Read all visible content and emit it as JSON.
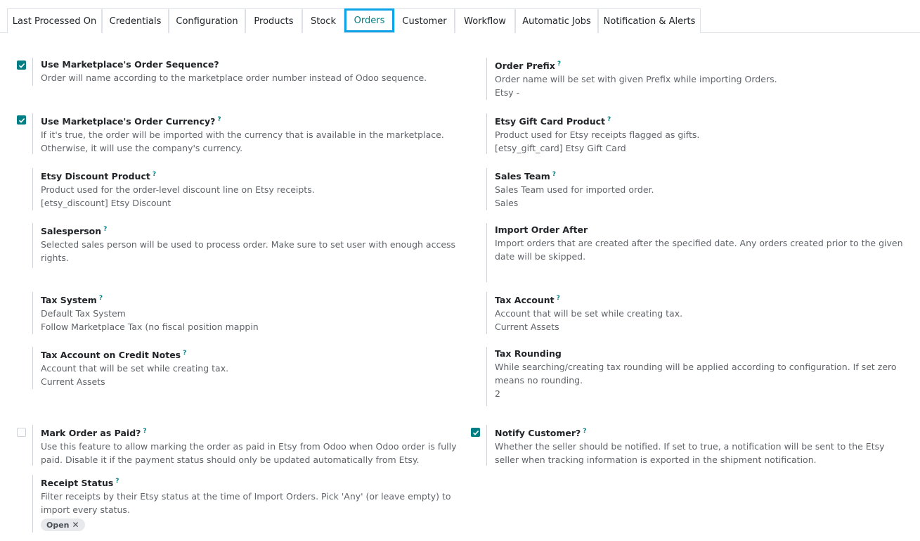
{
  "tabs": [
    {
      "label": "Last Processed On"
    },
    {
      "label": "Credentials"
    },
    {
      "label": "Configuration"
    },
    {
      "label": "Products"
    },
    {
      "label": "Stock"
    },
    {
      "label": "Orders",
      "active": true
    },
    {
      "label": "Customer"
    },
    {
      "label": "Workflow"
    },
    {
      "label": "Automatic Jobs"
    },
    {
      "label": "Notification & Alerts"
    }
  ],
  "settings": {
    "order_sequence": {
      "title": "Use Marketplace's Order Sequence?",
      "desc": "Order will name according to the marketplace order number instead of Odoo sequence.",
      "checked": true
    },
    "order_prefix": {
      "title": "Order Prefix",
      "help": "?",
      "desc": "Order name will be set with given Prefix while importing Orders.",
      "value": "Etsy -"
    },
    "order_currency": {
      "title": "Use Marketplace's Order Currency?",
      "help": "?",
      "desc": "If it's true, the order will be imported with the currency that is available in the marketplace. Otherwise, it will use the company's currency.",
      "checked": true
    },
    "gift_card_product": {
      "title": "Etsy Gift Card Product",
      "help": "?",
      "desc": "Product used for Etsy receipts flagged as gifts.",
      "value": "[etsy_gift_card] Etsy Gift Card"
    },
    "discount_product": {
      "title": "Etsy Discount Product",
      "help": "?",
      "desc": "Product used for the order-level discount line on Etsy receipts.",
      "value": "[etsy_discount] Etsy Discount"
    },
    "sales_team": {
      "title": "Sales Team",
      "help": "?",
      "desc": "Sales Team used for imported order.",
      "value": "Sales"
    },
    "salesperson": {
      "title": "Salesperson",
      "help": "?",
      "desc": "Selected sales person will be used to process order. Make sure to set user with enough access rights.",
      "value": ""
    },
    "import_after": {
      "title": "Import Order After",
      "desc": "Import orders that are created after the specified date. Any orders created prior to the given date will be skipped.",
      "value": ""
    },
    "tax_system": {
      "title": "Tax System",
      "help": "?",
      "desc": "Default Tax System",
      "value": "Follow Marketplace Tax (no fiscal position mappin"
    },
    "tax_account": {
      "title": "Tax Account",
      "help": "?",
      "desc": "Account that will be set while creating tax.",
      "value": "Current Assets"
    },
    "tax_account_credit": {
      "title": "Tax Account on Credit Notes",
      "help": "?",
      "desc": "Account that will be set while creating tax.",
      "value": "Current Assets"
    },
    "tax_rounding": {
      "title": "Tax Rounding",
      "desc": "While searching/creating tax rounding will be applied according to configuration. If set zero means no rounding.",
      "value": "2"
    },
    "mark_paid": {
      "title": "Mark Order as Paid?",
      "help": "?",
      "desc": "Use this feature to allow marking the order as paid in Etsy from Odoo when Odoo order is fully paid. Disable it if the payment status should only be updated automatically from Etsy.",
      "checked": false
    },
    "notify_customer": {
      "title": "Notify Customer?",
      "help": "?",
      "desc": "Whether the seller should be notified. If set to true, a notification will be sent to the Etsy seller when tracking information is exported in the shipment notification.",
      "checked": true
    },
    "receipt_status": {
      "title": "Receipt Status",
      "help": "?",
      "desc": "Filter receipts by their Etsy status at the time of Import Orders. Pick 'Any' (or leave empty) to import every status.",
      "tag": "Open",
      "tag_remove": "✕"
    }
  },
  "icons": {
    "check": "check-icon",
    "remove": "close-icon"
  },
  "colors": {
    "accent": "#017e84",
    "active_tab_border": "#0ea2e7"
  }
}
